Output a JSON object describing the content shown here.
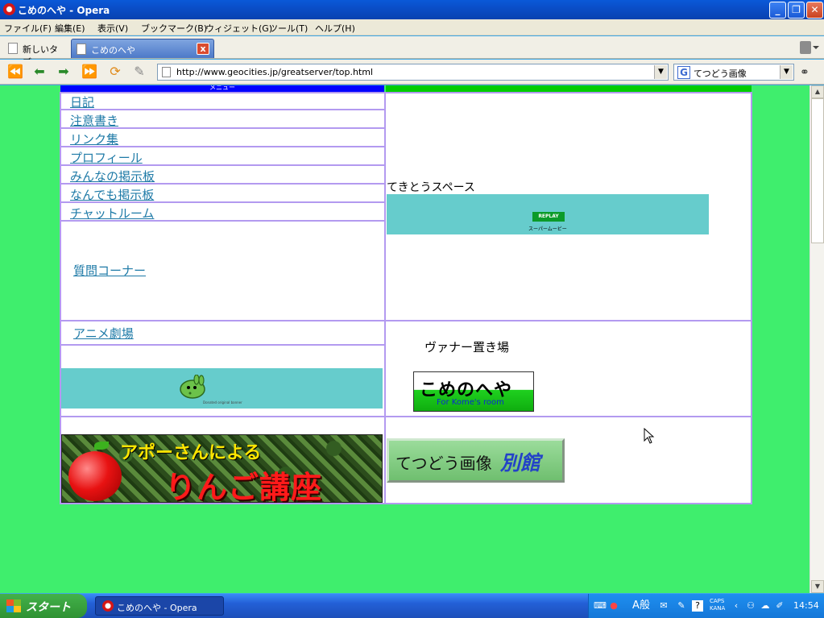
{
  "window": {
    "title": "こめのへや - Opera",
    "minimize": "_",
    "restore": "❐",
    "close": "✕"
  },
  "menu": [
    "ファイル(F)",
    "編集(E)",
    "表示(V)",
    "ブックマーク(B)",
    "ウィジェット(G)",
    "ツール(T)",
    "ヘルプ(H)"
  ],
  "tabs": {
    "new_tab": "新しいタブ",
    "active_tab": "こめのへや",
    "close": "x"
  },
  "address": {
    "url": "http://www.geocities.jp/greatserver/top.html",
    "search_engine": "G",
    "search_text": "てつどう画像"
  },
  "page": {
    "header_text": "メニュー",
    "menu_links": [
      "日記",
      "注意書き",
      "リンク集",
      "プロフィール",
      "みんなの掲示板",
      "なんでも掲示板",
      "チャットルーム"
    ],
    "question_corner": "質問コーナー",
    "free_space_label": "てきとうスペース",
    "replay_label": "REPLAY",
    "super_movie_label": "スーパームービー",
    "anime_theater": "アニメ劇場",
    "frog_caption": "Donated original banner",
    "banner_place_label": "ヴァナー置き場",
    "komeno_banner": {
      "title": "こめのへや",
      "subtitle": "For Kome's room"
    },
    "ringo_banner": {
      "line1": "アポーさんによる",
      "line2": "りんご講座"
    },
    "bekkan_banner": {
      "text": "てつどう画像",
      "accent": "別館"
    }
  },
  "taskbar": {
    "start": "スタート",
    "task_label": "こめのへや - Opera",
    "ime": "A般",
    "caps": "CAPS",
    "kana": "KANA",
    "clock": "14:54"
  },
  "colors": {
    "page_background": "#3fee6d",
    "grid_border": "#b39af0",
    "link": "#1e7aa7",
    "teal": "#66cccc"
  }
}
